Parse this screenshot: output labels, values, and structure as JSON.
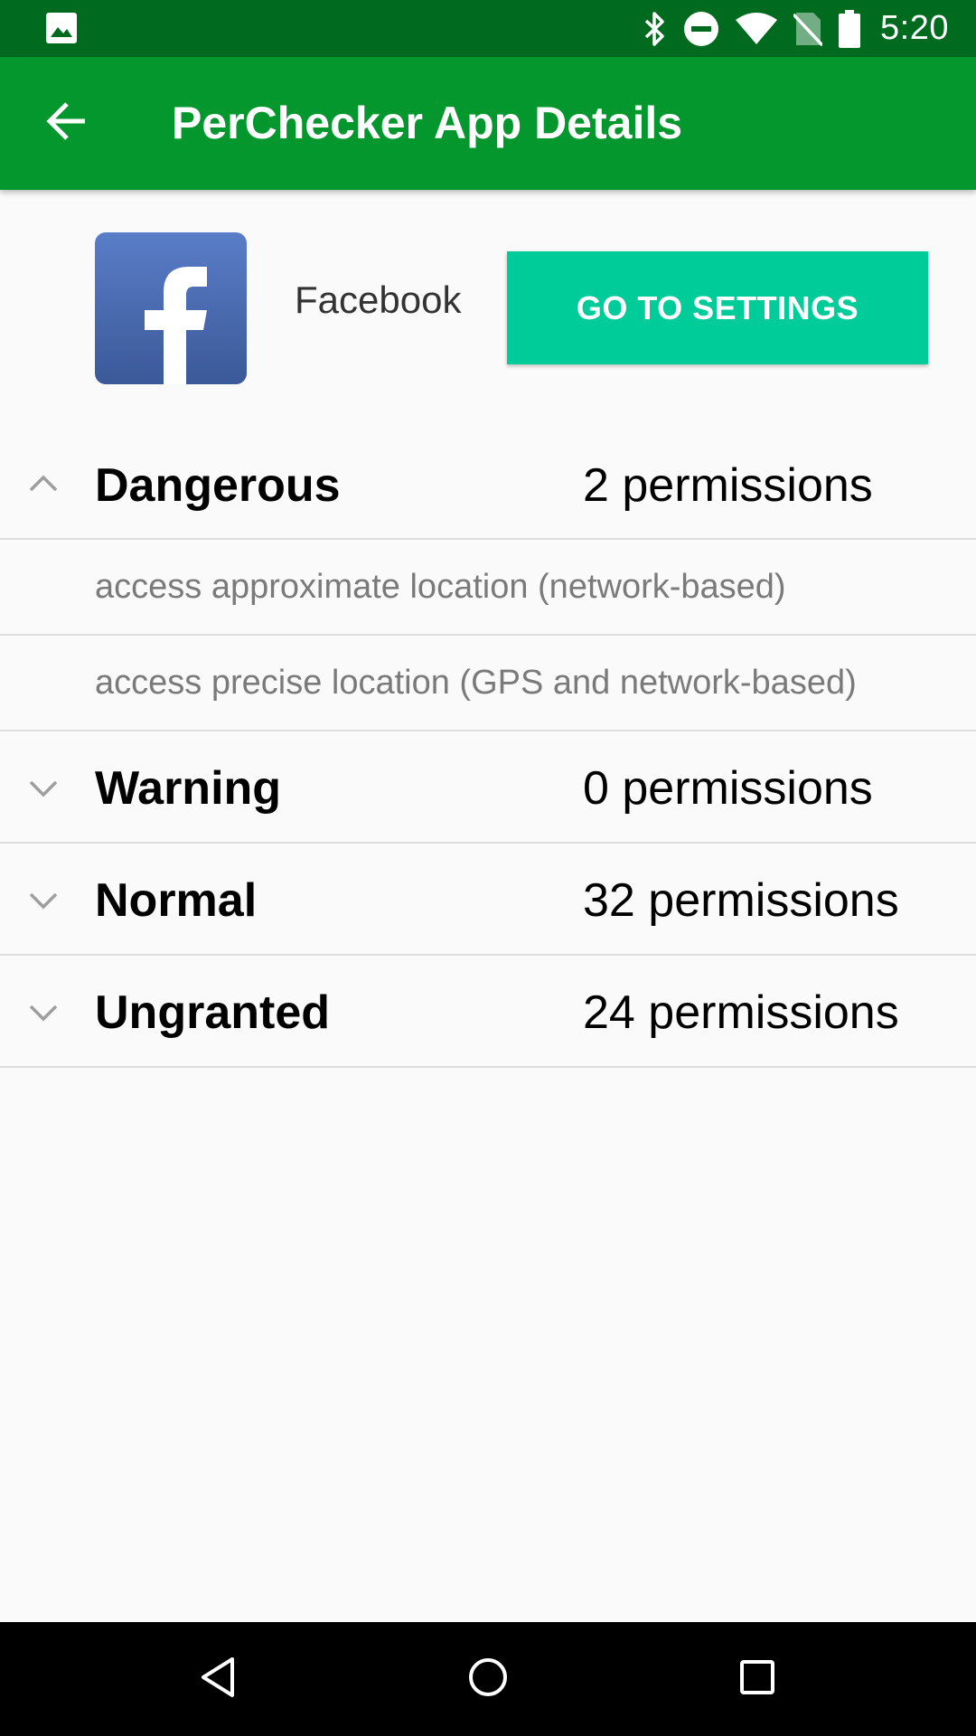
{
  "status_bar": {
    "time": "5:20",
    "left_icon": "image-notification-icon",
    "right_icons": [
      "bluetooth-icon",
      "do-not-disturb-icon",
      "wifi-icon",
      "no-sim-icon",
      "battery-icon"
    ]
  },
  "app_bar": {
    "title": "PerChecker App Details",
    "back_icon": "back-arrow-icon",
    "color": "#03972e",
    "status_color": "#006b1f"
  },
  "app": {
    "name": "Facebook",
    "icon": "facebook-logo",
    "settings_button": "GO TO SETTINGS",
    "button_color": "#00cc99"
  },
  "groups": [
    {
      "name": "Dangerous",
      "count": "2 permissions",
      "expanded": true,
      "items": [
        "access approximate location (network-based)",
        "access precise location (GPS and network-based)"
      ]
    },
    {
      "name": "Warning",
      "count": "0 permissions",
      "expanded": false
    },
    {
      "name": "Normal",
      "count": "32 permissions",
      "expanded": false
    },
    {
      "name": "Ungranted",
      "count": "24 permissions",
      "expanded": false
    }
  ],
  "nav_bar": {
    "buttons": [
      "back-triangle-icon",
      "home-circle-icon",
      "recents-square-icon"
    ]
  }
}
